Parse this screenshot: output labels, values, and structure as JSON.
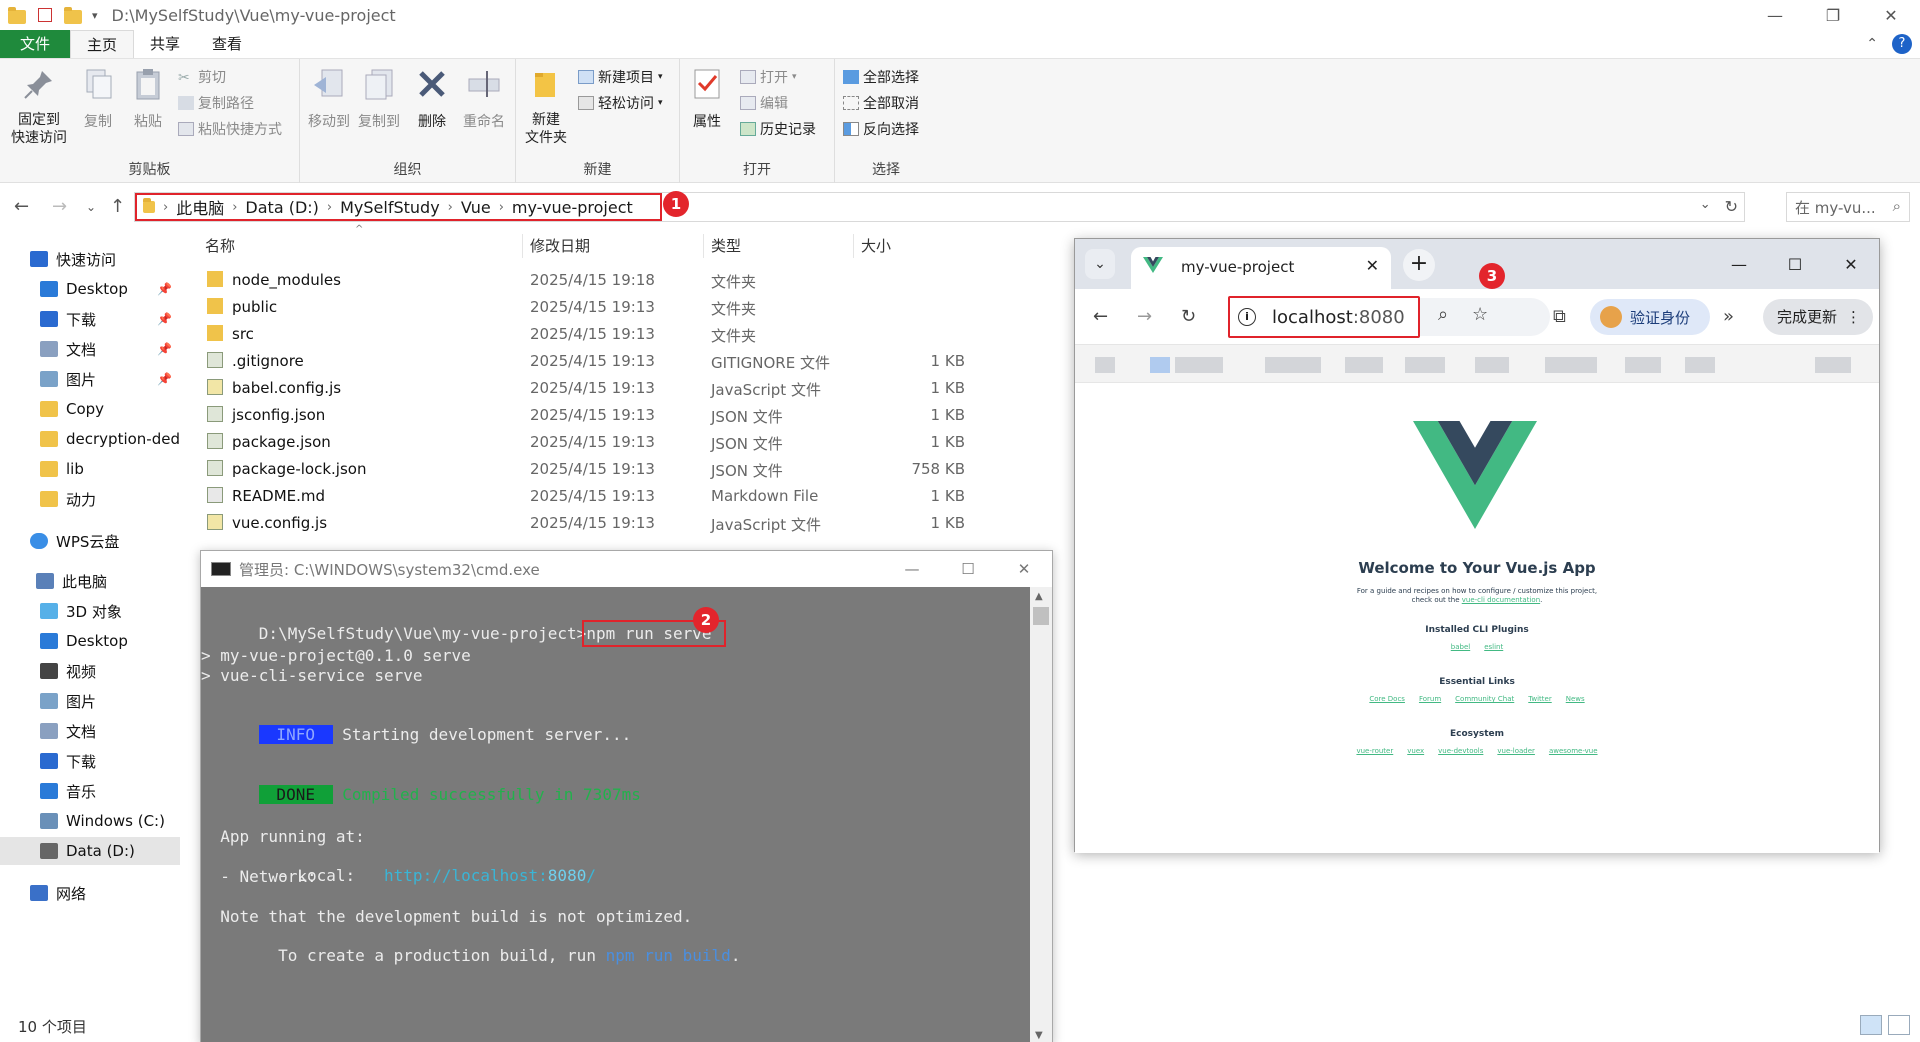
{
  "explorer": {
    "title_path": "D:\\MySelfStudy\\Vue\\my-vue-project",
    "menu_tabs": [
      "文件",
      "主页",
      "共享",
      "查看"
    ],
    "ribbon": {
      "clipboard": {
        "label": "剪贴板",
        "pin": "固定到\n快速访问",
        "copy": "复制",
        "paste": "粘贴",
        "cut": "剪切",
        "copy_path": "复制路径",
        "paste_shortcut": "粘贴快捷方式"
      },
      "organize": {
        "label": "组织",
        "move_to": "移动到",
        "copy_to": "复制到",
        "delete": "删除",
        "rename": "重命名"
      },
      "new": {
        "label": "新建",
        "new_folder": "新建\n文件夹",
        "new_item": "新建项目",
        "easy_access": "轻松访问"
      },
      "open": {
        "label": "打开",
        "properties": "属性",
        "open": "打开",
        "edit": "编辑",
        "history": "历史记录"
      },
      "select": {
        "label": "选择",
        "select_all": "全部选择",
        "select_none": "全部取消",
        "invert": "反向选择"
      }
    },
    "breadcrumb": [
      "此电脑",
      "Data (D:)",
      "MySelfStudy",
      "Vue",
      "my-vue-project"
    ],
    "search_placeholder": "在 my-vu...",
    "nav": [
      {
        "label": "快速访问",
        "pinned": false
      },
      {
        "label": "Desktop",
        "pinned": true
      },
      {
        "label": "下载",
        "pinned": true
      },
      {
        "label": "文档",
        "pinned": true
      },
      {
        "label": "图片",
        "pinned": true
      },
      {
        "label": "Copy",
        "pinned": false
      },
      {
        "label": "decryption-ded",
        "pinned": false
      },
      {
        "label": "lib",
        "pinned": false
      },
      {
        "label": "动力",
        "pinned": false
      },
      {
        "label": "WPS云盘",
        "pinned": false
      },
      {
        "label": "此电脑",
        "pinned": false
      },
      {
        "label": "3D 对象",
        "pinned": false
      },
      {
        "label": "Desktop",
        "pinned": false
      },
      {
        "label": "视频",
        "pinned": false
      },
      {
        "label": "图片",
        "pinned": false
      },
      {
        "label": "文档",
        "pinned": false
      },
      {
        "label": "下载",
        "pinned": false
      },
      {
        "label": "音乐",
        "pinned": false
      },
      {
        "label": "Windows (C:)",
        "pinned": false
      },
      {
        "label": "Data (D:)",
        "pinned": false
      },
      {
        "label": "网络",
        "pinned": false
      }
    ],
    "columns": [
      "名称",
      "修改日期",
      "类型",
      "大小"
    ],
    "files": [
      {
        "name": "node_modules",
        "date": "2025/4/15 19:18",
        "type": "文件夹",
        "size": "",
        "icon": "folder"
      },
      {
        "name": "public",
        "date": "2025/4/15 19:13",
        "type": "文件夹",
        "size": "",
        "icon": "folder"
      },
      {
        "name": "src",
        "date": "2025/4/15 19:13",
        "type": "文件夹",
        "size": "",
        "icon": "folder"
      },
      {
        "name": ".gitignore",
        "date": "2025/4/15 19:13",
        "type": "GITIGNORE 文件",
        "size": "1 KB",
        "icon": "file"
      },
      {
        "name": "babel.config.js",
        "date": "2025/4/15 19:13",
        "type": "JavaScript 文件",
        "size": "1 KB",
        "icon": "js"
      },
      {
        "name": "jsconfig.json",
        "date": "2025/4/15 19:13",
        "type": "JSON 文件",
        "size": "1 KB",
        "icon": "file"
      },
      {
        "name": "package.json",
        "date": "2025/4/15 19:13",
        "type": "JSON 文件",
        "size": "1 KB",
        "icon": "file"
      },
      {
        "name": "package-lock.json",
        "date": "2025/4/15 19:13",
        "type": "JSON 文件",
        "size": "758 KB",
        "icon": "file"
      },
      {
        "name": "README.md",
        "date": "2025/4/15 19:13",
        "type": "Markdown File",
        "size": "1 KB",
        "icon": "md"
      },
      {
        "name": "vue.config.js",
        "date": "2025/4/15 19:13",
        "type": "JavaScript 文件",
        "size": "1 KB",
        "icon": "js"
      }
    ],
    "status": "10 个项目",
    "badge1": "1"
  },
  "cmd": {
    "title": "管理员: C:\\WINDOWS\\system32\\cmd.exe",
    "prompt": "D:\\MySelfStudy\\Vue\\my-vue-project>",
    "command": "npm run serve",
    "badge2": "2",
    "line_serve1": "> my-vue-project@0.1.0 serve",
    "line_serve2": "> vue-cli-service serve",
    "info_tag": " INFO ",
    "info_text": " Starting development server...",
    "done_tag": " DONE ",
    "done_text": " Compiled successfully in 7307ms",
    "running": "  App running at:",
    "local_label": "  - Local:   ",
    "local_url_host": "http://localhost:",
    "local_url_port": "8080",
    "local_url_end": "/",
    "network": "  - Network: ",
    "note1": "  Note that the development build is not optimized.",
    "note2_a": "  To create a production build, run ",
    "note2_b": "npm run build",
    "note2_c": "."
  },
  "browser": {
    "tab_title": "my-vue-project",
    "url_host": "localhost",
    "url_port": ":8080",
    "badge3": "3",
    "profile": "验证身份",
    "update": "完成更新",
    "page": {
      "title": "Welcome to Your Vue.js App",
      "sub1": "For a guide and recipes on how to configure / customize this project,",
      "sub2_a": "check out the ",
      "sub2_link": "vue-cli documentation",
      "sub2_b": ".",
      "plugins_head": "Installed CLI Plugins",
      "plugins": [
        "babel",
        "eslint"
      ],
      "links_head": "Essential Links",
      "links": [
        "Core Docs",
        "Forum",
        "Community Chat",
        "Twitter",
        "News"
      ],
      "eco_head": "Ecosystem",
      "eco": [
        "vue-router",
        "vuex",
        "vue-devtools",
        "vue-loader",
        "awesome-vue"
      ]
    }
  },
  "colors": {
    "ribbon_file": "#1f8a3c",
    "highlight_red": "#e0232b",
    "vue_green": "#42b983",
    "vue_dark": "#35495e"
  }
}
